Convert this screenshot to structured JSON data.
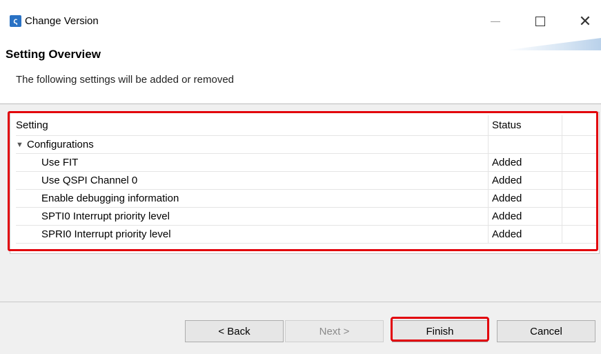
{
  "window": {
    "title": "Change Version",
    "app_icon": "renesas-logo-icon",
    "controls": {
      "minimize": "minimize-icon",
      "maximize": "maximize-icon",
      "close": "close-icon"
    }
  },
  "header": {
    "title": "Setting Overview",
    "description": "The following settings will be added or removed"
  },
  "table": {
    "columns": {
      "setting": "Setting",
      "status": "Status"
    },
    "group": {
      "label": "Configurations",
      "expanded": true
    },
    "rows": [
      {
        "setting": "Use FIT",
        "status": "Added"
      },
      {
        "setting": "Use QSPI Channel 0",
        "status": "Added"
      },
      {
        "setting": "Enable debugging information",
        "status": "Added"
      },
      {
        "setting": "SPTI0 Interrupt priority level",
        "status": "Added"
      },
      {
        "setting": "SPRI0 Interrupt priority level",
        "status": "Added"
      }
    ]
  },
  "buttons": {
    "back": "< Back",
    "next": "Next >",
    "finish": "Finish",
    "cancel": "Cancel"
  },
  "colors": {
    "highlight": "#e2000a",
    "dialog_bg": "#f0f0f0",
    "icon_blue": "#2a72c4"
  }
}
